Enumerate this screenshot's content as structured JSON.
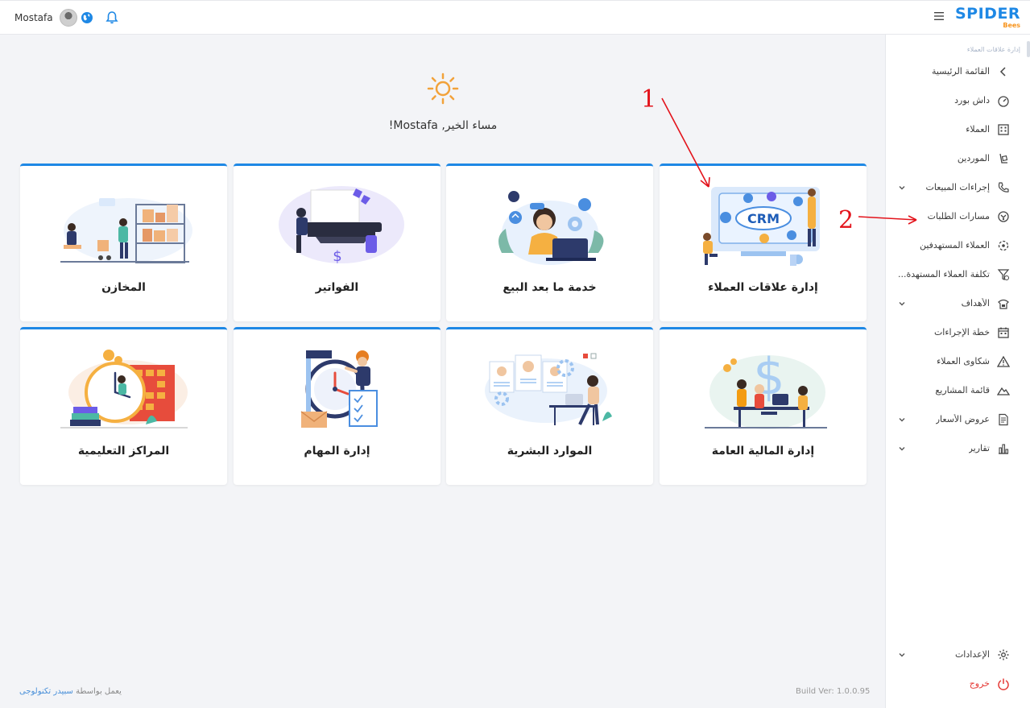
{
  "topbar": {
    "user_name": "Mostafa",
    "brand_name": "SPIDER",
    "brand_sub": "Bees"
  },
  "sidebar": {
    "breadcrumb": "إدارة علاقات العملاء",
    "items": [
      {
        "label": "القائمة الرئيسية",
        "icon": "chevron-left-icon"
      },
      {
        "label": "داش بورد",
        "icon": "gauge-icon"
      },
      {
        "label": "العملاء",
        "icon": "building-icon"
      },
      {
        "label": "الموردين",
        "icon": "dolly-icon"
      },
      {
        "label": "إجراءات المبيعات",
        "icon": "phone-icon",
        "expandable": true
      },
      {
        "label": "مسارات الطلبات",
        "icon": "route-icon"
      },
      {
        "label": "العملاء المستهدفين",
        "icon": "target-users-icon"
      },
      {
        "label": "تكلفة العملاء المستهدة...",
        "icon": "funnel-dollar-icon"
      },
      {
        "label": "الأهداف",
        "icon": "goals-icon",
        "expandable": true
      },
      {
        "label": "خطة الإجراءات",
        "icon": "calendar-icon"
      },
      {
        "label": "شكاوى العملاء",
        "icon": "warning-icon"
      },
      {
        "label": "قائمة المشاريع",
        "icon": "mountain-icon"
      },
      {
        "label": "عروض الأسعار",
        "icon": "quote-doc-icon",
        "expandable": true
      },
      {
        "label": "تقارير",
        "icon": "bar-chart-icon",
        "expandable": true
      }
    ],
    "settings_label": "الإعدادات",
    "logout_label": "خروج"
  },
  "main": {
    "greeting": "مساء الخير, Mostafa!",
    "cards": [
      {
        "title": "إدارة علاقات العملاء",
        "art": "crm-illustration"
      },
      {
        "title": "خدمة ما بعد البيع",
        "art": "support-illustration"
      },
      {
        "title": "الفواتير",
        "art": "invoice-illustration"
      },
      {
        "title": "المخازن",
        "art": "warehouse-illustration"
      },
      {
        "title": "إدارة المالية العامة",
        "art": "finance-illustration"
      },
      {
        "title": "الموارد البشرية",
        "art": "hr-illustration"
      },
      {
        "title": "إدارة المهام",
        "art": "tasks-illustration"
      },
      {
        "title": "المراكز التعليمية",
        "art": "education-illustration"
      }
    ],
    "crm_art_text": "CRM"
  },
  "footer": {
    "powered_prefix": "يعمل بواسطة",
    "powered_brand": "سبيدر تكنولوجى",
    "build": "Build Ver: 1.0.0.95"
  },
  "annotations": {
    "marker_1": "1",
    "marker_2": "2"
  },
  "colors": {
    "accent": "#1e88e5",
    "brand_orange": "#f7941d",
    "logout": "#e53935",
    "annotation": "#e3131b"
  }
}
